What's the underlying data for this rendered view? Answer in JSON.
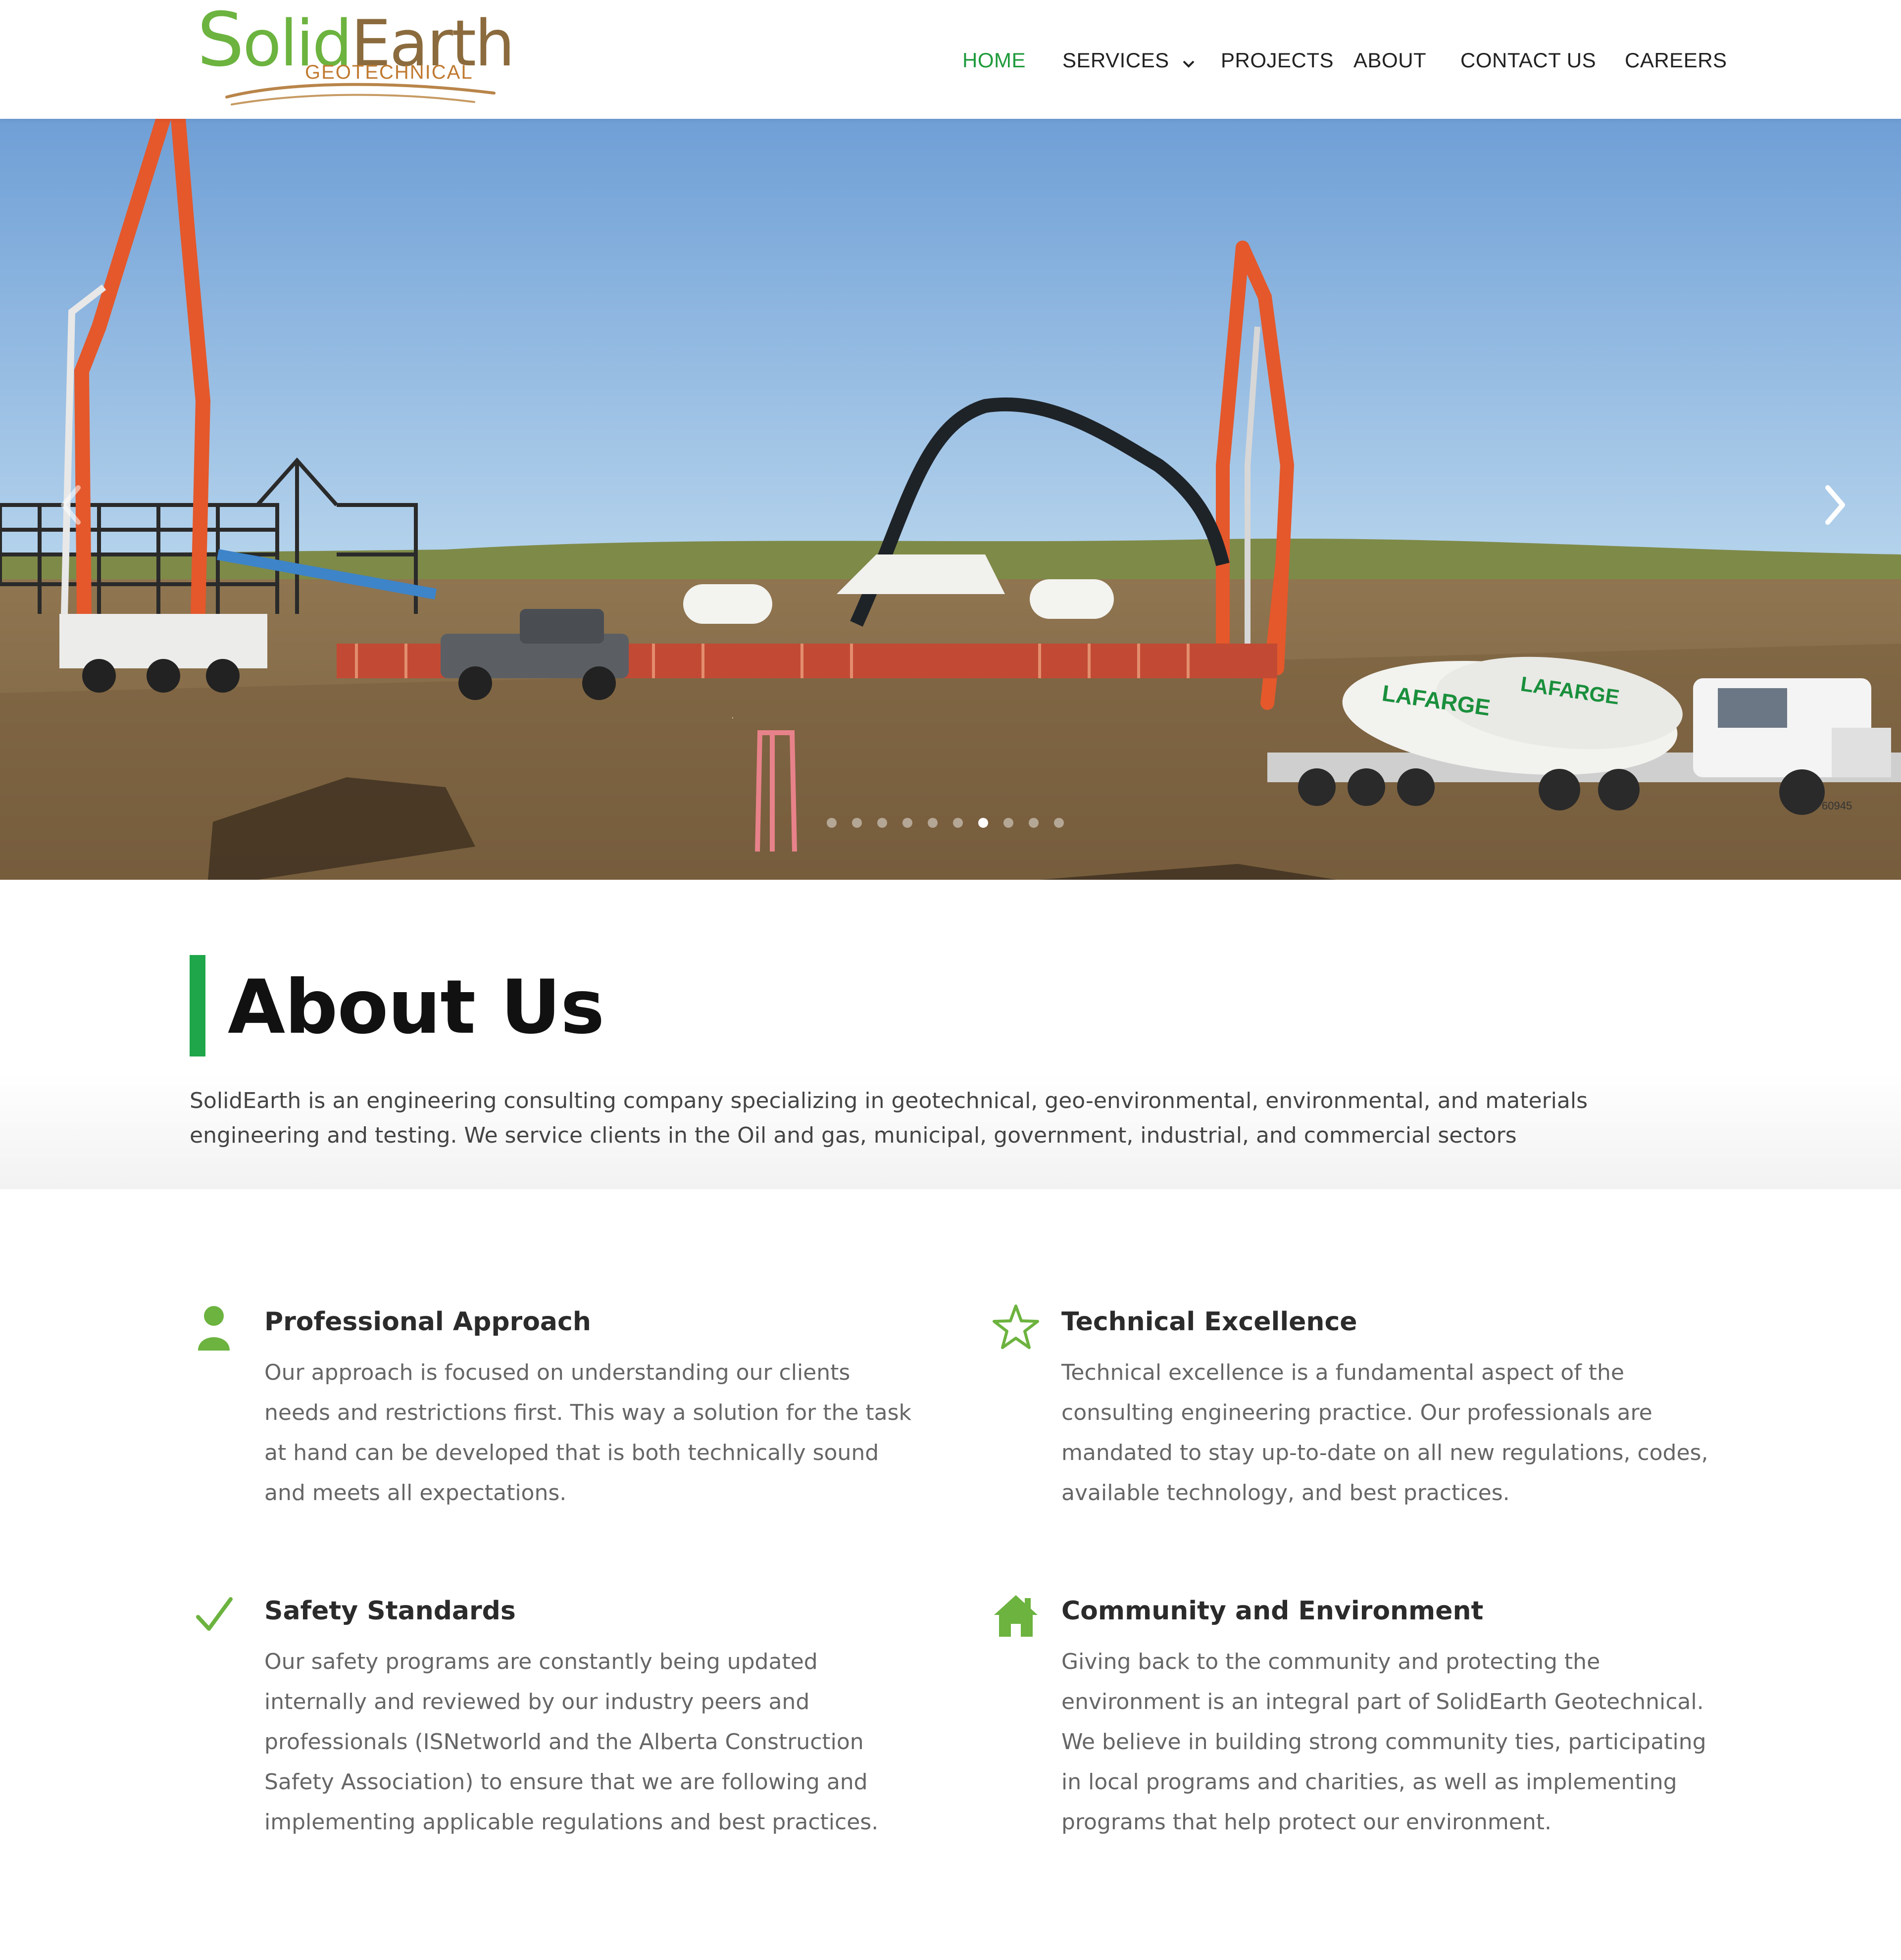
{
  "brand": {
    "logo_letter": "S",
    "logo_solid": "olid",
    "logo_earth": "Earth",
    "logo_sub": "GEOTECHNICAL",
    "green": "#6cb33f",
    "brown": "#8b6b3d",
    "orange": "#c07a31"
  },
  "nav": {
    "items": [
      {
        "label": "HOME",
        "active": true
      },
      {
        "label": "SERVICES",
        "has_dropdown": true,
        "icon": "chevron-down-icon"
      },
      {
        "label": "PROJECTS"
      },
      {
        "label": "ABOUT"
      },
      {
        "label": "CONTACT US"
      },
      {
        "label": "CAREERS"
      }
    ],
    "active_color": "#1e9a3c"
  },
  "hero": {
    "image_description": "Construction site with concrete pump trucks and LAFARGE mixer trucks",
    "truck_label_1": "LAFARGE",
    "truck_label_2": "LAFARGE",
    "plate": "60945",
    "prev_icon": "chevron-left-icon",
    "next_icon": "chevron-right-icon",
    "slide_count": 10,
    "active_slide": 7
  },
  "about": {
    "title": "About Us",
    "accent_color": "#1fa64a",
    "text": "SolidEarth is an engineering consulting company specializing in geotechnical, geo-environmental, environmental, and materials engineering and testing. We service clients in the Oil and gas, municipal, government, industrial, and commercial sectors"
  },
  "features": [
    {
      "icon": "person-icon",
      "title": "Professional Approach",
      "text": "Our approach is focused on understanding our clients needs and restrictions first. This way a solution for the task at hand can be developed that is both technically sound and meets all expectations."
    },
    {
      "icon": "star-icon",
      "title": "Technical Excellence",
      "text": "Technical excellence is a fundamental aspect of the consulting engineering practice. Our professionals are mandated to stay up-to-date on all new regulations, codes, available technology, and best practices."
    },
    {
      "icon": "checkmark-icon",
      "title": "Safety Standards",
      "text": "Our safety programs are constantly being updated internally and reviewed by our industry peers and professionals (ISNetworld and the Alberta Construction Safety Association) to ensure that we are following and implementing applicable regulations and best practices."
    },
    {
      "icon": "house-icon",
      "title": "Community and Environment",
      "text": "Giving back to the community and protecting the environment is an integral part of SolidEarth Geotechnical. We believe in building strong community ties, participating in local programs and charities, as well as implementing programs that help protect our environment."
    }
  ],
  "icon_color": "#6cb33f"
}
